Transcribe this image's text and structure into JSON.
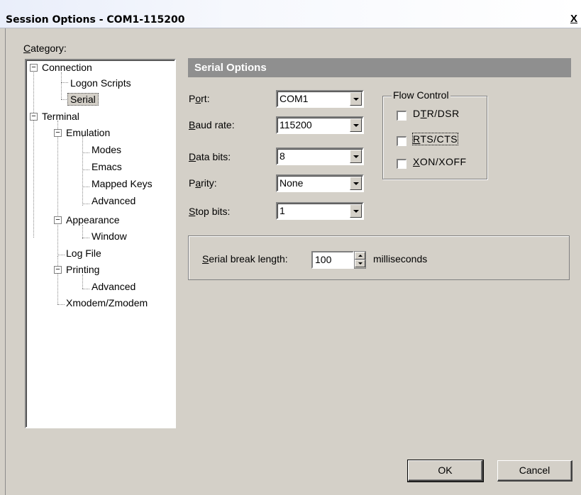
{
  "window": {
    "title": "Session Options - COM1-115200",
    "close_label": "X"
  },
  "category": {
    "label_u": "C",
    "label_rest": "ategory:"
  },
  "tree": {
    "connection": "Connection",
    "logon_scripts": "Logon Scripts",
    "serial": "Serial",
    "terminal": "Terminal",
    "emulation": "Emulation",
    "modes": "Modes",
    "emacs": "Emacs",
    "mapped_keys": "Mapped Keys",
    "advanced1": "Advanced",
    "appearance": "Appearance",
    "window": "Window",
    "log_file": "Log File",
    "printing": "Printing",
    "advanced2": "Advanced",
    "xmodem": "Xmodem/Zmodem",
    "expander_symbol": "−"
  },
  "serial_options": {
    "header": "Serial Options",
    "port": {
      "label_pre": "P",
      "label_u": "o",
      "label_post": "rt:",
      "value": "COM1"
    },
    "baud_rate": {
      "label_u": "B",
      "label_post": "aud rate:",
      "value": "115200"
    },
    "data_bits": {
      "label_u": "D",
      "label_post": "ata bits:",
      "value": "8"
    },
    "parity": {
      "label_pre": "P",
      "label_u": "a",
      "label_post": "rity:",
      "value": "None"
    },
    "stop_bits": {
      "label_u": "S",
      "label_post": "top bits:",
      "value": "1"
    }
  },
  "flow_control": {
    "legend": "Flow Control",
    "dtr_dsr": {
      "pre": "D",
      "u": "T",
      "post": "R/DSR",
      "checked": false
    },
    "rts_cts": {
      "u": "R",
      "post": "TS/CTS",
      "checked": false
    },
    "xon_xoff": {
      "u": "X",
      "post": "ON/XOFF",
      "checked": false
    }
  },
  "serial_break": {
    "label_u": "S",
    "label_post": "erial break length:",
    "value": "100",
    "unit": "milliseconds"
  },
  "buttons": {
    "ok": "OK",
    "cancel": "Cancel"
  }
}
